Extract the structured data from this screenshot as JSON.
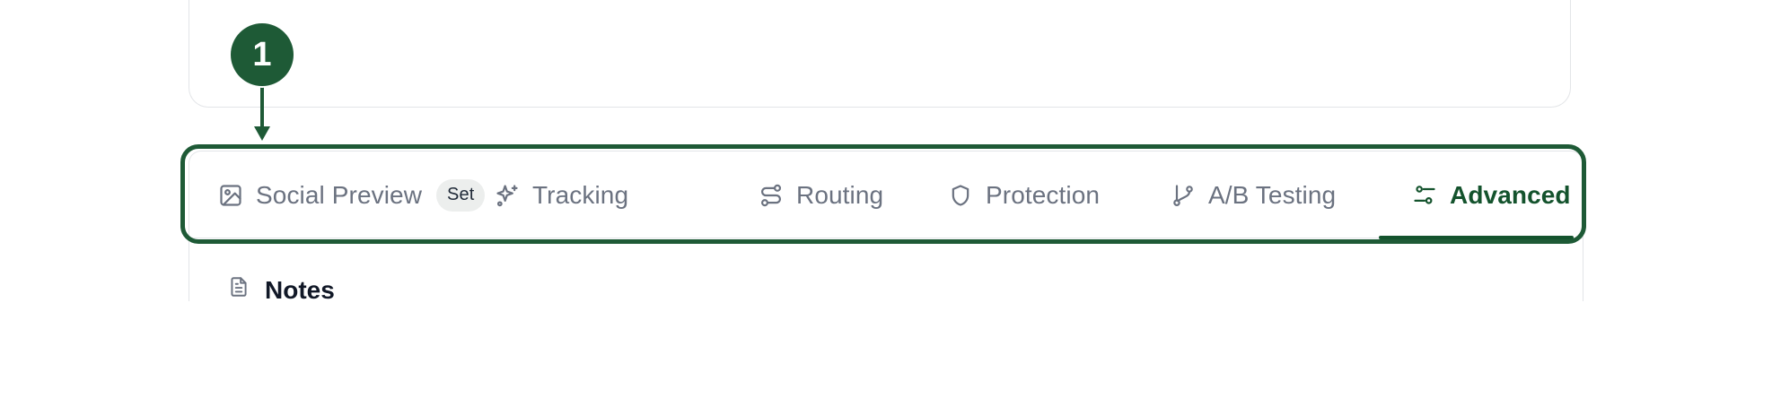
{
  "tabs": [
    {
      "label": "Social Preview",
      "icon": "image-icon",
      "badge": "Set",
      "active": false
    },
    {
      "label": "Tracking",
      "icon": "sparkles-icon",
      "active": false
    },
    {
      "label": "Routing",
      "icon": "route-icon",
      "active": false
    },
    {
      "label": "Protection",
      "icon": "shield-icon",
      "active": false
    },
    {
      "label": "A/B Testing",
      "icon": "git-branch-icon",
      "active": false
    },
    {
      "label": "Advanced",
      "icon": "sliders-icon",
      "active": true
    }
  ],
  "notes": {
    "title": "Notes",
    "icon": "file-text-icon"
  },
  "annotation": {
    "marker": "1"
  },
  "colors": {
    "accent": "#14532d",
    "annotation": "#1e5a36",
    "inactive_text": "#6b7280",
    "border": "#e3e5e8",
    "badge_bg": "#eceeed"
  }
}
